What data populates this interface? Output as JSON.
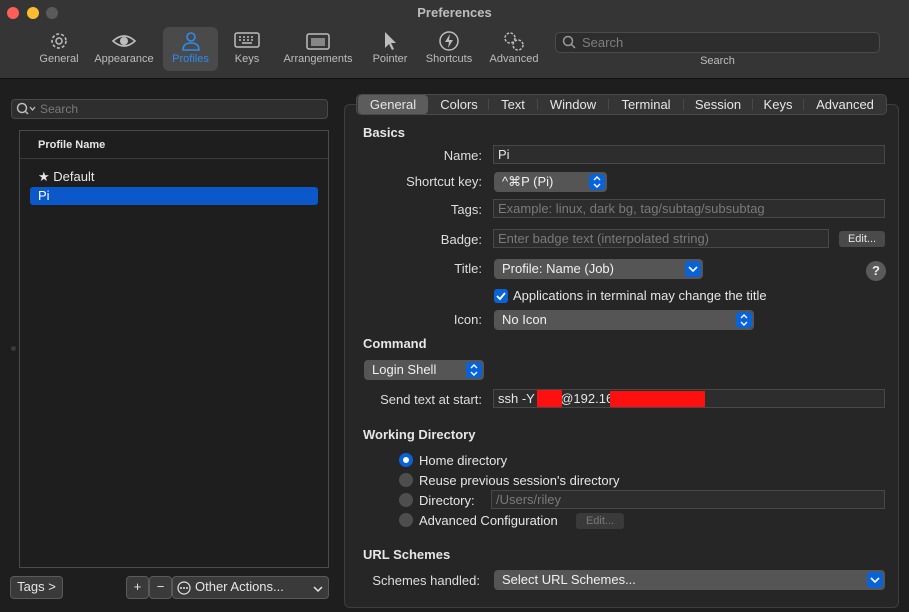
{
  "window": {
    "title": "Preferences"
  },
  "toolbar": {
    "items": [
      {
        "label": "General",
        "icon": "gear-icon"
      },
      {
        "label": "Appearance",
        "icon": "eye-icon"
      },
      {
        "label": "Profiles",
        "icon": "person-icon",
        "active": true
      },
      {
        "label": "Keys",
        "icon": "keyboard-icon"
      },
      {
        "label": "Arrangements",
        "icon": "window-arrangement-icon"
      },
      {
        "label": "Pointer",
        "icon": "pointer-icon"
      },
      {
        "label": "Shortcuts",
        "icon": "lightning-icon"
      },
      {
        "label": "Advanced",
        "icon": "gears-icon"
      }
    ],
    "search": {
      "placeholder": "Search",
      "caption": "Search"
    }
  },
  "left": {
    "search_placeholder": "Search",
    "list_header": "Profile Name",
    "profiles": [
      {
        "label": "★ Default"
      },
      {
        "label": "Pi",
        "selected": true
      }
    ],
    "tags_button": "Tags >",
    "plus_button": "+",
    "minus_button": "−",
    "other_actions": "Other Actions..."
  },
  "tabs": [
    "General",
    "Colors",
    "Text",
    "Window",
    "Terminal",
    "Session",
    "Keys",
    "Advanced"
  ],
  "basics": {
    "title": "Basics",
    "name_label": "Name:",
    "name_value": "Pi",
    "shortcut_label": "Shortcut key:",
    "shortcut_value": "^⌘P (Pi)",
    "tags_label": "Tags:",
    "tags_placeholder": "Example: linux, dark bg, tag/subtag/subsubtag",
    "badge_label": "Badge:",
    "badge_placeholder": "Enter badge text (interpolated string)",
    "badge_edit": "Edit...",
    "title_label": "Title:",
    "title_value": "Profile: Name (Job)",
    "help": "?",
    "apps_change_title": "Applications in terminal may change the title",
    "icon_label": "Icon:",
    "icon_value": "No Icon"
  },
  "command": {
    "title": "Command",
    "shell_value": "Login Shell",
    "send_text_label": "Send text at start:",
    "send_text_parts": [
      "ssh -Y ",
      "@192.16"
    ]
  },
  "working_dir": {
    "title": "Working Directory",
    "options": [
      "Home directory",
      "Reuse previous session's directory",
      "Directory:",
      "Advanced Configuration"
    ],
    "directory_placeholder": "/Users/riley",
    "edit": "Edit..."
  },
  "url": {
    "title": "URL Schemes",
    "schemes_label": "Schemes handled:",
    "schemes_value": "Select URL Schemes..."
  },
  "colors": {
    "accent": "#0a63d6",
    "selection": "#0a58ca",
    "redaction": "#ff1010"
  }
}
